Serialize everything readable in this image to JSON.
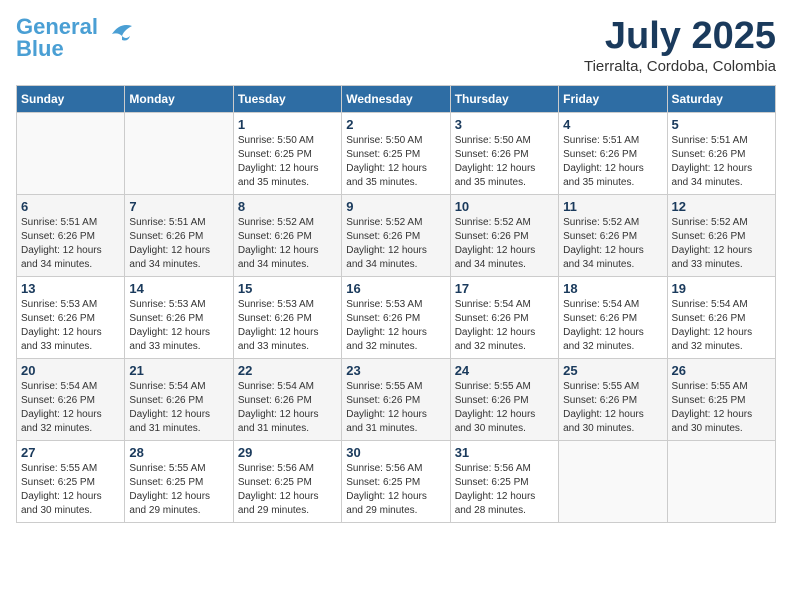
{
  "header": {
    "logo_line1": "General",
    "logo_line2": "Blue",
    "month": "July 2025",
    "location": "Tierralta, Cordoba, Colombia"
  },
  "weekdays": [
    "Sunday",
    "Monday",
    "Tuesday",
    "Wednesday",
    "Thursday",
    "Friday",
    "Saturday"
  ],
  "weeks": [
    [
      {
        "day": "",
        "info": ""
      },
      {
        "day": "",
        "info": ""
      },
      {
        "day": "1",
        "info": "Sunrise: 5:50 AM\nSunset: 6:25 PM\nDaylight: 12 hours\nand 35 minutes."
      },
      {
        "day": "2",
        "info": "Sunrise: 5:50 AM\nSunset: 6:25 PM\nDaylight: 12 hours\nand 35 minutes."
      },
      {
        "day": "3",
        "info": "Sunrise: 5:50 AM\nSunset: 6:26 PM\nDaylight: 12 hours\nand 35 minutes."
      },
      {
        "day": "4",
        "info": "Sunrise: 5:51 AM\nSunset: 6:26 PM\nDaylight: 12 hours\nand 35 minutes."
      },
      {
        "day": "5",
        "info": "Sunrise: 5:51 AM\nSunset: 6:26 PM\nDaylight: 12 hours\nand 34 minutes."
      }
    ],
    [
      {
        "day": "6",
        "info": "Sunrise: 5:51 AM\nSunset: 6:26 PM\nDaylight: 12 hours\nand 34 minutes."
      },
      {
        "day": "7",
        "info": "Sunrise: 5:51 AM\nSunset: 6:26 PM\nDaylight: 12 hours\nand 34 minutes."
      },
      {
        "day": "8",
        "info": "Sunrise: 5:52 AM\nSunset: 6:26 PM\nDaylight: 12 hours\nand 34 minutes."
      },
      {
        "day": "9",
        "info": "Sunrise: 5:52 AM\nSunset: 6:26 PM\nDaylight: 12 hours\nand 34 minutes."
      },
      {
        "day": "10",
        "info": "Sunrise: 5:52 AM\nSunset: 6:26 PM\nDaylight: 12 hours\nand 34 minutes."
      },
      {
        "day": "11",
        "info": "Sunrise: 5:52 AM\nSunset: 6:26 PM\nDaylight: 12 hours\nand 34 minutes."
      },
      {
        "day": "12",
        "info": "Sunrise: 5:52 AM\nSunset: 6:26 PM\nDaylight: 12 hours\nand 33 minutes."
      }
    ],
    [
      {
        "day": "13",
        "info": "Sunrise: 5:53 AM\nSunset: 6:26 PM\nDaylight: 12 hours\nand 33 minutes."
      },
      {
        "day": "14",
        "info": "Sunrise: 5:53 AM\nSunset: 6:26 PM\nDaylight: 12 hours\nand 33 minutes."
      },
      {
        "day": "15",
        "info": "Sunrise: 5:53 AM\nSunset: 6:26 PM\nDaylight: 12 hours\nand 33 minutes."
      },
      {
        "day": "16",
        "info": "Sunrise: 5:53 AM\nSunset: 6:26 PM\nDaylight: 12 hours\nand 32 minutes."
      },
      {
        "day": "17",
        "info": "Sunrise: 5:54 AM\nSunset: 6:26 PM\nDaylight: 12 hours\nand 32 minutes."
      },
      {
        "day": "18",
        "info": "Sunrise: 5:54 AM\nSunset: 6:26 PM\nDaylight: 12 hours\nand 32 minutes."
      },
      {
        "day": "19",
        "info": "Sunrise: 5:54 AM\nSunset: 6:26 PM\nDaylight: 12 hours\nand 32 minutes."
      }
    ],
    [
      {
        "day": "20",
        "info": "Sunrise: 5:54 AM\nSunset: 6:26 PM\nDaylight: 12 hours\nand 32 minutes."
      },
      {
        "day": "21",
        "info": "Sunrise: 5:54 AM\nSunset: 6:26 PM\nDaylight: 12 hours\nand 31 minutes."
      },
      {
        "day": "22",
        "info": "Sunrise: 5:54 AM\nSunset: 6:26 PM\nDaylight: 12 hours\nand 31 minutes."
      },
      {
        "day": "23",
        "info": "Sunrise: 5:55 AM\nSunset: 6:26 PM\nDaylight: 12 hours\nand 31 minutes."
      },
      {
        "day": "24",
        "info": "Sunrise: 5:55 AM\nSunset: 6:26 PM\nDaylight: 12 hours\nand 30 minutes."
      },
      {
        "day": "25",
        "info": "Sunrise: 5:55 AM\nSunset: 6:26 PM\nDaylight: 12 hours\nand 30 minutes."
      },
      {
        "day": "26",
        "info": "Sunrise: 5:55 AM\nSunset: 6:25 PM\nDaylight: 12 hours\nand 30 minutes."
      }
    ],
    [
      {
        "day": "27",
        "info": "Sunrise: 5:55 AM\nSunset: 6:25 PM\nDaylight: 12 hours\nand 30 minutes."
      },
      {
        "day": "28",
        "info": "Sunrise: 5:55 AM\nSunset: 6:25 PM\nDaylight: 12 hours\nand 29 minutes."
      },
      {
        "day": "29",
        "info": "Sunrise: 5:56 AM\nSunset: 6:25 PM\nDaylight: 12 hours\nand 29 minutes."
      },
      {
        "day": "30",
        "info": "Sunrise: 5:56 AM\nSunset: 6:25 PM\nDaylight: 12 hours\nand 29 minutes."
      },
      {
        "day": "31",
        "info": "Sunrise: 5:56 AM\nSunset: 6:25 PM\nDaylight: 12 hours\nand 28 minutes."
      },
      {
        "day": "",
        "info": ""
      },
      {
        "day": "",
        "info": ""
      }
    ]
  ]
}
